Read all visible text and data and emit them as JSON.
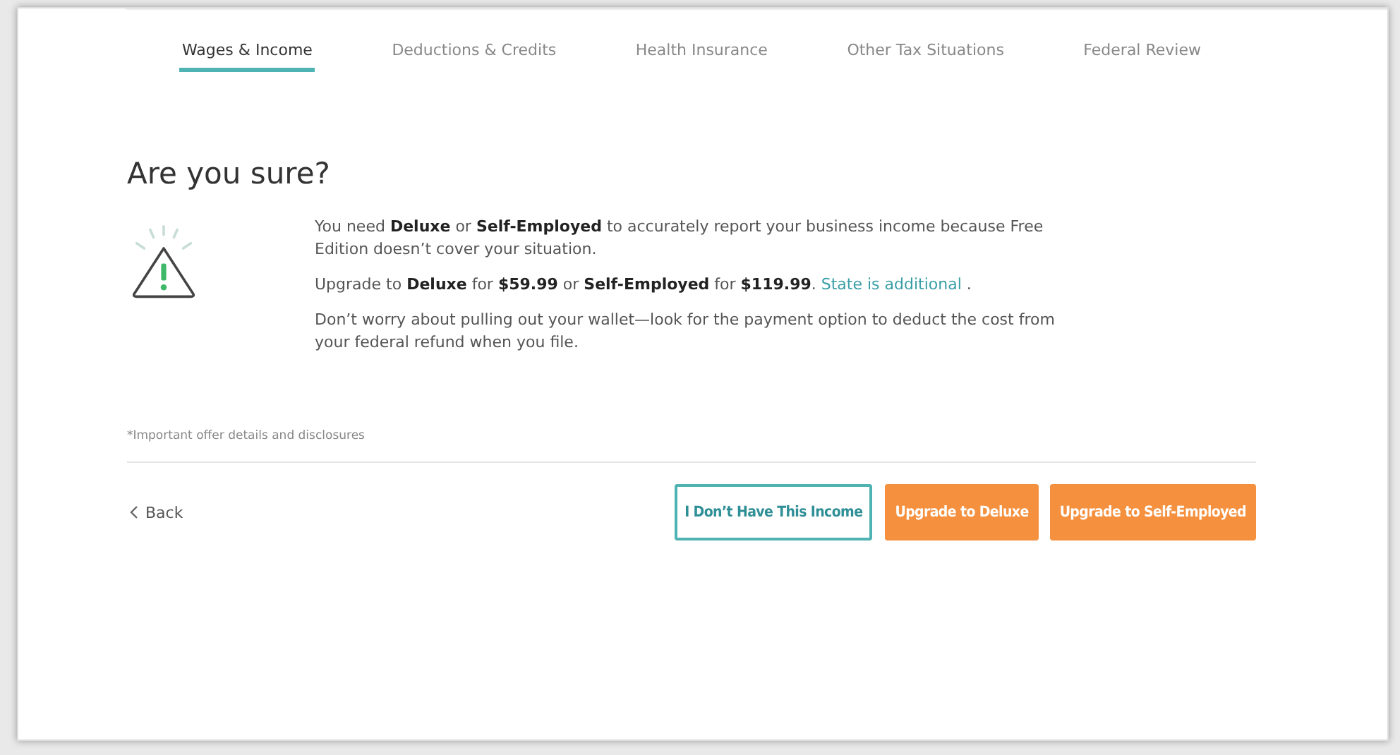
{
  "tabs": [
    {
      "label": "Wages & Income",
      "selected": true
    },
    {
      "label": "Deductions & Credits",
      "selected": false
    },
    {
      "label": "Health Insurance",
      "selected": false
    },
    {
      "label": "Other Tax Situations",
      "selected": false
    },
    {
      "label": "Federal Review",
      "selected": false
    }
  ],
  "heading": "Are you sure?",
  "paragraphs": [
    {
      "text": "You need **Deluxe** or **Self-Employed** to accurately report your business income because Free Edition doesn’t cover your situation."
    },
    {
      "text": "Upgrade to **Deluxe** for **$59.99** or **Self-Employed** for **$119.99**.",
      "link": "State is additional",
      "after": "."
    },
    {
      "text": "Don’t worry about pulling out your wallet—look for the payment option to deduct the cost from your federal refund when you file."
    }
  ],
  "disclosure": "*Important offer details and disclosures",
  "back": "Back",
  "buttons": [
    {
      "label": "I Don’t Have This Income",
      "kind": "outline"
    },
    {
      "label": "Upgrade to Deluxe",
      "kind": "primary"
    },
    {
      "label": "Upgrade to Self-Employed",
      "kind": "primary"
    }
  ]
}
